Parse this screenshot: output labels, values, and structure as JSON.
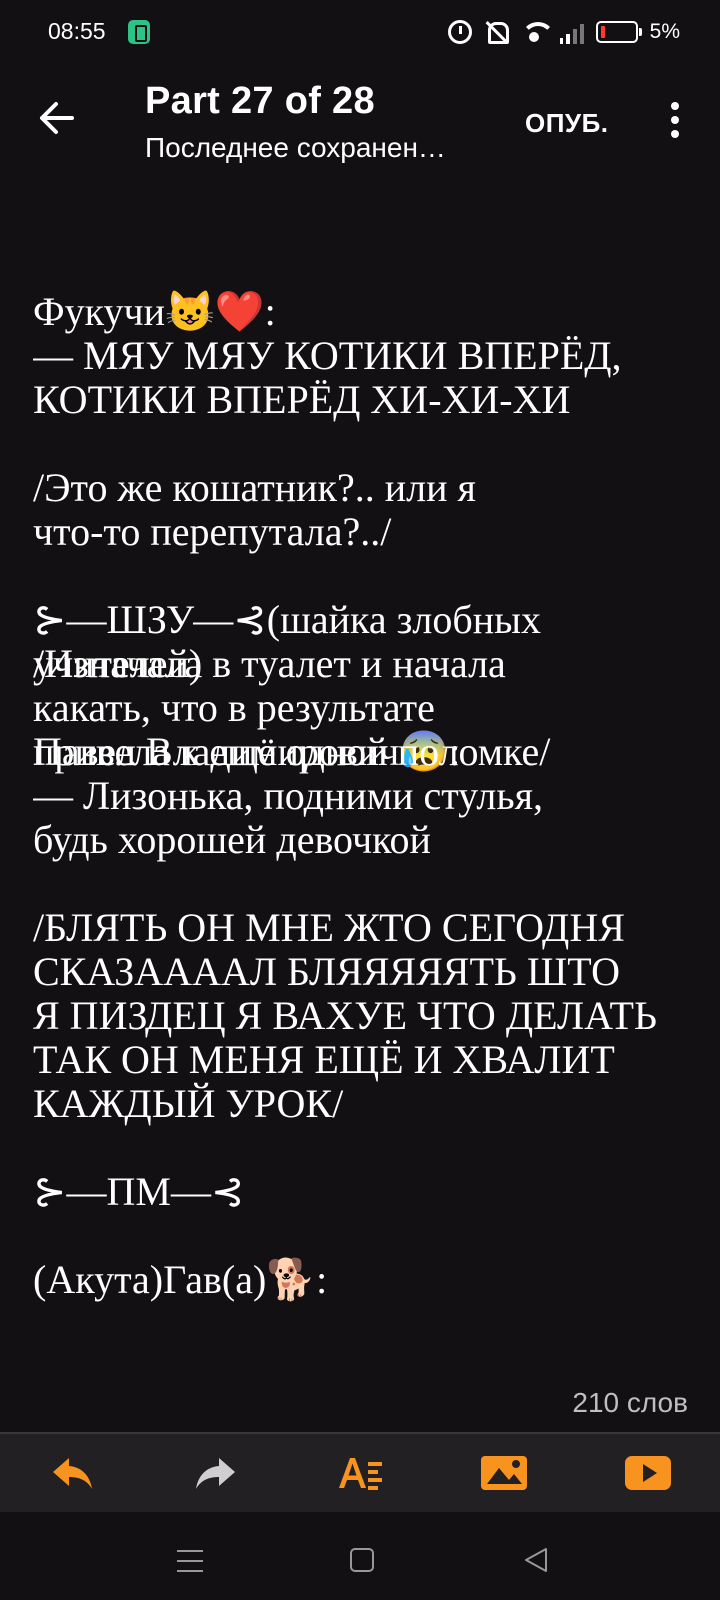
{
  "status_bar": {
    "time": "08:55",
    "battery_percent": "5%",
    "icons": [
      "battery-saver-icon",
      "alarm-icon",
      "mute-icon",
      "wifi-icon",
      "signal-icon",
      "battery-icon"
    ]
  },
  "header": {
    "title": "Part 27 of 28",
    "subtitle": "Последнее сохранен…",
    "publish_label": "ОПУБ."
  },
  "story": {
    "lines": [
      "Фукучи😺❤️:",
      "— МЯУ МЯУ КОТИКИ ВПЕРЁД,",
      "КОТИКИ ВПЕРЁД ХИ-ХИ-ХИ",
      "",
      "/Это же кошатник?.. или я",
      "что-то перепутала?../",
      "",
      "⊱—ШЗУ—⊰(шайка злобных"
    ],
    "overlap_line_1_a": "учителей)",
    "overlap_line_1_b": "/Изначала в туалет и начала",
    "line_after_overlap_1": "какать, что в результате",
    "overlap_line_2_a": "Павел Владимирович😰:",
    "overlap_line_2_b": "привела к ещё одной поломке/",
    "lines_after": [
      "— Лизонька, подними стулья,",
      "будь хорошей девочкой",
      "",
      "/БЛЯТЬ ОН МНЕ ЖТО СЕГОДНЯ",
      "СКАЗАААAЛ БЛЯЯЯЯЯТЬ ШТО",
      "Я  ПИЗДЕЦ Я ВАХУЕ ЧТО ДЕЛАТЬ",
      "ТАК ОН МЕНЯ ЕЩЁ И ХВАЛИТ",
      "КАЖДЫЙ УРОК/",
      "",
      "⊱—ПМ—⊰",
      "",
      "(Акута)Гав(а)🐕:"
    ]
  },
  "word_count": "210 слов",
  "toolbar": {
    "accent_color": "#f7931e",
    "icons": [
      "undo-icon",
      "redo-icon",
      "text-format-icon",
      "insert-image-icon",
      "insert-video-icon"
    ]
  },
  "navbar": {
    "icons": [
      "recent-apps-icon",
      "home-icon",
      "back-icon"
    ]
  }
}
